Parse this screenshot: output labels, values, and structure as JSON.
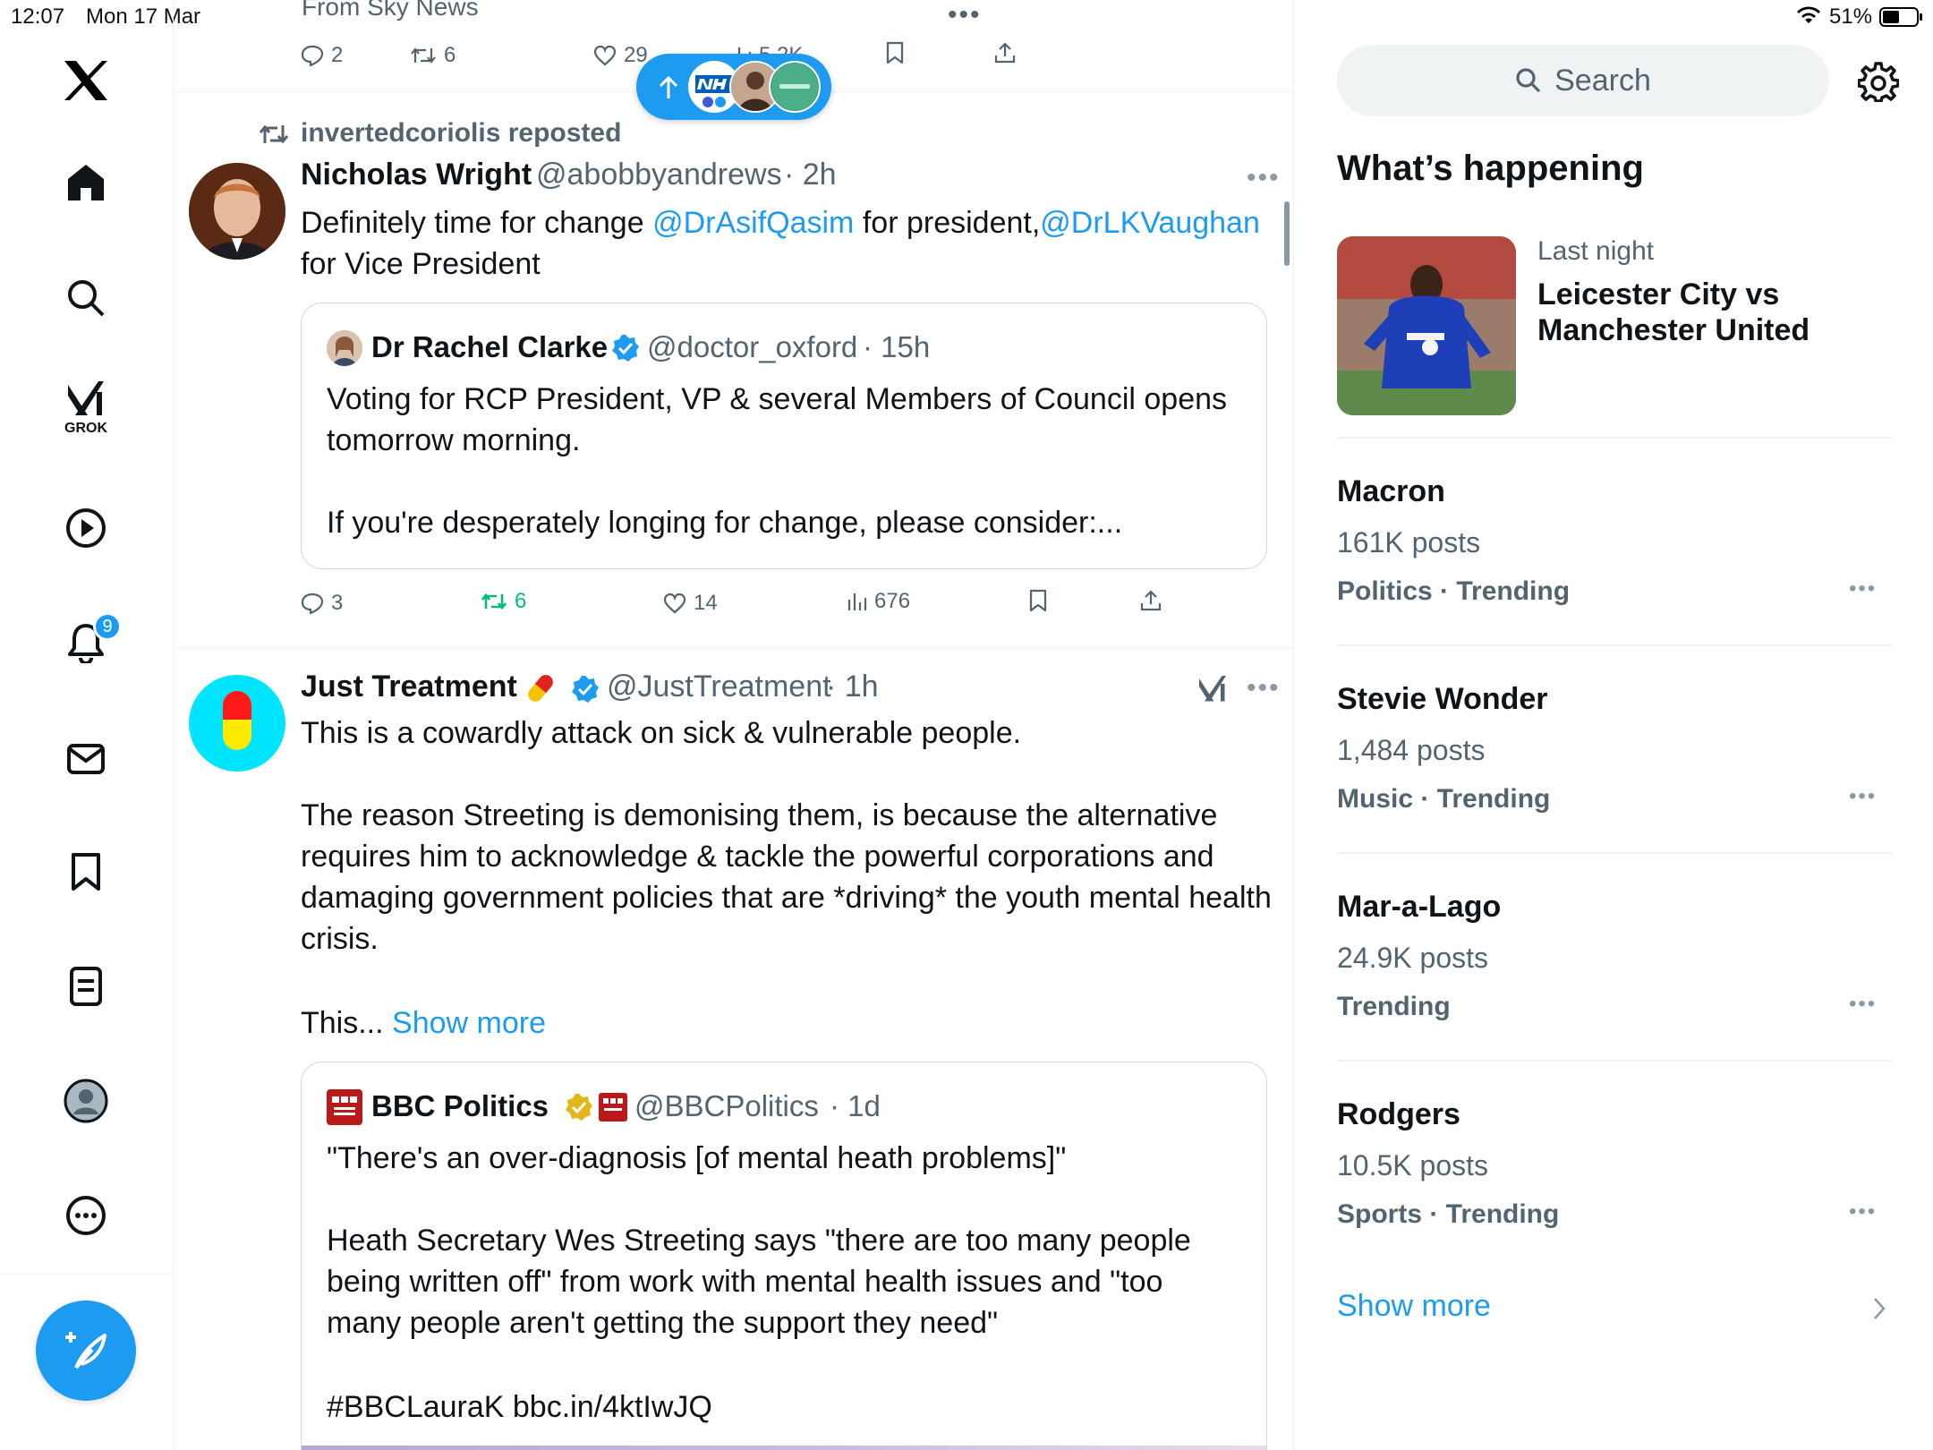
{
  "status": {
    "time": "12:07",
    "date": "Mon 17 Mar",
    "battery": "51%"
  },
  "nav": {
    "grok_label": "GROK",
    "notifications_badge": "9"
  },
  "top_tweet": {
    "from_text": "From Sky News",
    "replies": "2",
    "reposts": "6",
    "likes": "29",
    "views": "5.2K"
  },
  "tweet1": {
    "repost_by": "invertedcoriolis reposted",
    "name": "Nicholas Wright",
    "handle": "@abobbyandrews",
    "time": "· 2h",
    "text_a": "Definitely time for change ",
    "mention1": "@DrAsifQasim",
    "text_b": " for president,",
    "mention2": "@DrLKVaughan",
    "text_c": "for Vice President",
    "quote": {
      "name": "Dr Rachel Clarke",
      "handle": "@doctor_oxford",
      "time": "· 15h",
      "line1": "Voting for RCP President, VP & several Members of Council opens",
      "line2": "tomorrow morning.",
      "line3": "If you're desperately longing for change, please consider:..."
    },
    "replies": "3",
    "reposts": "6",
    "likes": "14",
    "views": "676"
  },
  "tweet2": {
    "name": "Just Treatment",
    "handle": "@JustTreatment",
    "time": "· 1h",
    "line1": "This is a cowardly attack on sick & vulnerable people.",
    "para2": "The reason Streeting is demonising them, is because the alternative requires him to acknowledge & tackle the powerful corporations and damaging government policies that are *driving* the youth mental health crisis.",
    "this_prefix": "This...",
    "show_more": "Show more",
    "quote": {
      "name": "BBC Politics",
      "handle": "@BBCPolitics",
      "time": "· 1d",
      "line1": "\"There's an over-diagnosis [of mental heath problems]\"",
      "para2": "Heath Secretary Wes Streeting says \"there are too many people being written off\" from work with mental health issues and \"too many people aren't getting the support they need\"",
      "line3": "#BBCLauraK bbc.in/4ktIwJQ"
    }
  },
  "sidebar": {
    "search_placeholder": "Search",
    "heading": "What’s happening",
    "featured": {
      "meta": "Last night",
      "title_line1": "Leicester City vs",
      "title_line2": "Manchester United"
    },
    "trends": [
      {
        "name": "Macron",
        "posts": "161K posts",
        "context": "Politics · Trending"
      },
      {
        "name": "Stevie Wonder",
        "posts": "1,484 posts",
        "context": "Music · Trending"
      },
      {
        "name": "Mar-a-Lago",
        "posts": "24.9K posts",
        "context": "Trending"
      },
      {
        "name": "Rodgers",
        "posts": "10.5K posts",
        "context": "Sports · Trending"
      }
    ],
    "show_more": "Show more"
  },
  "colors": {
    "accent": "#1d9bf0",
    "repost_green": "#00ba7c",
    "text": "#0f1419",
    "secondary": "#536471"
  }
}
